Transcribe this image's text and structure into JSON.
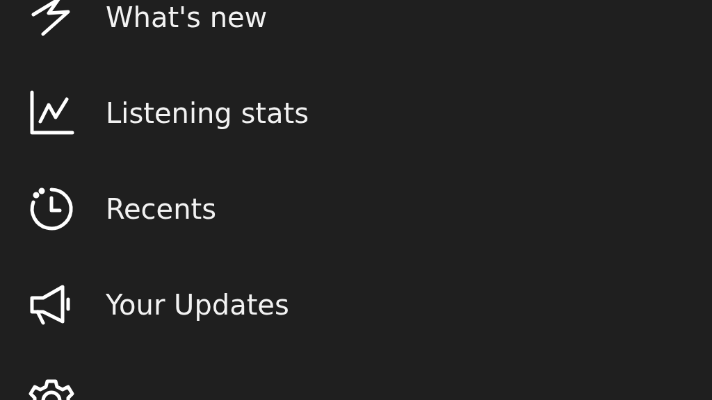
{
  "menu": {
    "items": [
      {
        "label": "What's new"
      },
      {
        "label": "Listening stats"
      },
      {
        "label": "Recents"
      },
      {
        "label": "Your Updates"
      }
    ]
  }
}
